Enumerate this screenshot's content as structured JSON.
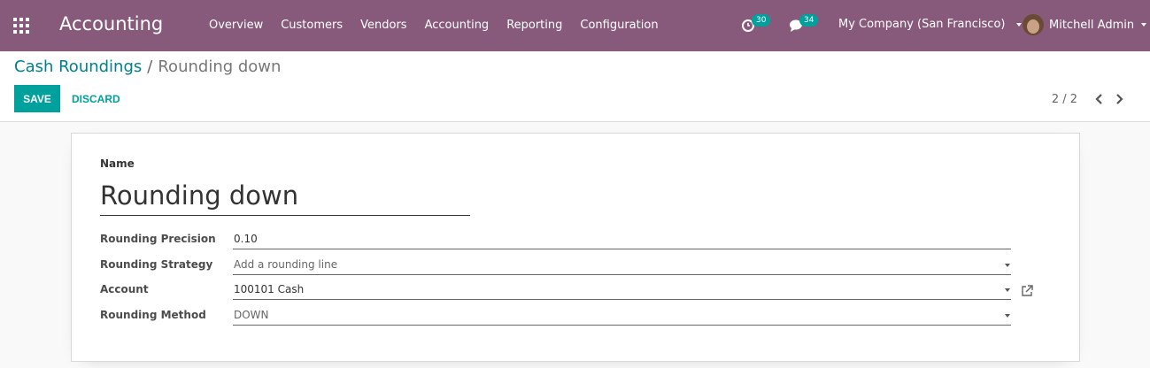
{
  "navbar": {
    "app_title": "Accounting",
    "menu": [
      {
        "label": "Overview"
      },
      {
        "label": "Customers"
      },
      {
        "label": "Vendors"
      },
      {
        "label": "Accounting"
      },
      {
        "label": "Reporting"
      },
      {
        "label": "Configuration"
      }
    ],
    "activity_count": "30",
    "message_count": "34",
    "company": "My Company (San Francisco)",
    "user": "Mitchell Admin",
    "accent_color": "#875a7b"
  },
  "control_panel": {
    "breadcrumb_parent": "Cash Roundings",
    "breadcrumb_separator": "/",
    "breadcrumb_current": "Rounding down",
    "save_label": "SAVE",
    "discard_label": "DISCARD",
    "pager": "2 / 2"
  },
  "form": {
    "name_label": "Name",
    "name_value": "Rounding down",
    "fields": [
      {
        "label": "Rounding Precision",
        "value": "0.10"
      },
      {
        "label": "Rounding Strategy",
        "value": "Add a rounding line"
      },
      {
        "label": "Account",
        "value": "100101 Cash"
      },
      {
        "label": "Rounding Method",
        "value": "DOWN"
      }
    ]
  }
}
